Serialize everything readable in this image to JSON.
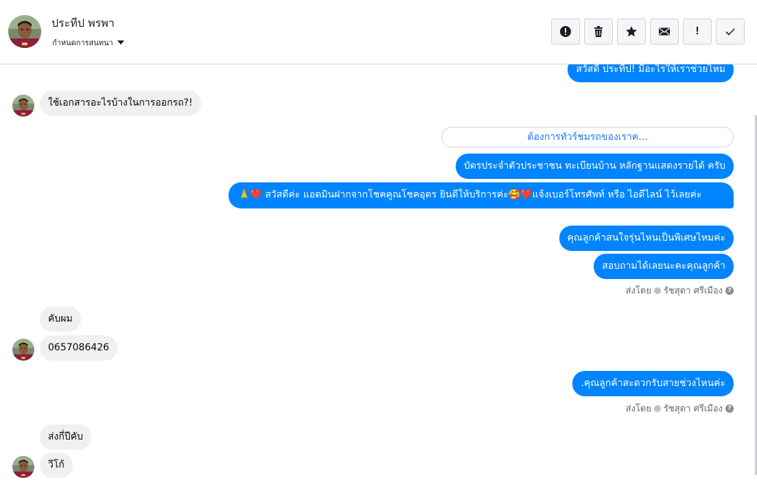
{
  "header": {
    "contact_name": "ประทีป พรพา",
    "label_dropdown": "กำหนดการสนทนา",
    "toolbar": [
      {
        "name": "report-spam-button",
        "icon": "alert-circle-icon"
      },
      {
        "name": "delete-button",
        "icon": "trash-icon"
      },
      {
        "name": "star-button",
        "icon": "star-icon"
      },
      {
        "name": "mark-unread-button",
        "icon": "envelope-icon"
      },
      {
        "name": "follow-up-button",
        "icon": "exclamation-icon",
        "glyph": "!"
      },
      {
        "name": "mark-done-button",
        "icon": "checkmark-icon"
      }
    ]
  },
  "messages": {
    "m1": "สวัสดี ประทีป! มีอะไรให้เราช่วยไหม",
    "m2": "ใช้เอกสารอะไรบ้างในการออกรถ?!",
    "quick_reply": "ต้องการทัวร์ชมรถของเราค...",
    "m3": "บัตรประจำตัวประชาชน ทะเบียนบ้าน หลักฐานแสดงรายได้ ครับ",
    "m4": "🙏❤️ สวัสดีค่ะ แอดมินฝากจากโชคคูณโชคอุดร ยินดีให้บริการค่ะ🥰❤️แจ้งเบอร์โทรศัพท์ หรือ ไอดีไลน์  ไว้เลยค่ะ",
    "m5": "คุณลูกค้าสนใจรุ่นไหนเป็นพิเศษไหมค่ะ",
    "m6": "สอบถามได้เลยนะคะคุณลูกค้า",
    "m7": "คับผม",
    "m8": "0657086426",
    "m9": ".คุณลูกค้าสะดวกรับสายช่วงไหนค่ะ",
    "m10": "ส่งกี่ปีคับ",
    "m11": "วีโก้"
  },
  "sent_by": {
    "prefix": "ส่งโดย",
    "agent": "รัชสุดา ศรีเมือง",
    "help": "?"
  },
  "colors": {
    "outgoing_bubble": "#0084ff",
    "incoming_bubble": "#f0f0f0",
    "link": "#1877f2"
  }
}
